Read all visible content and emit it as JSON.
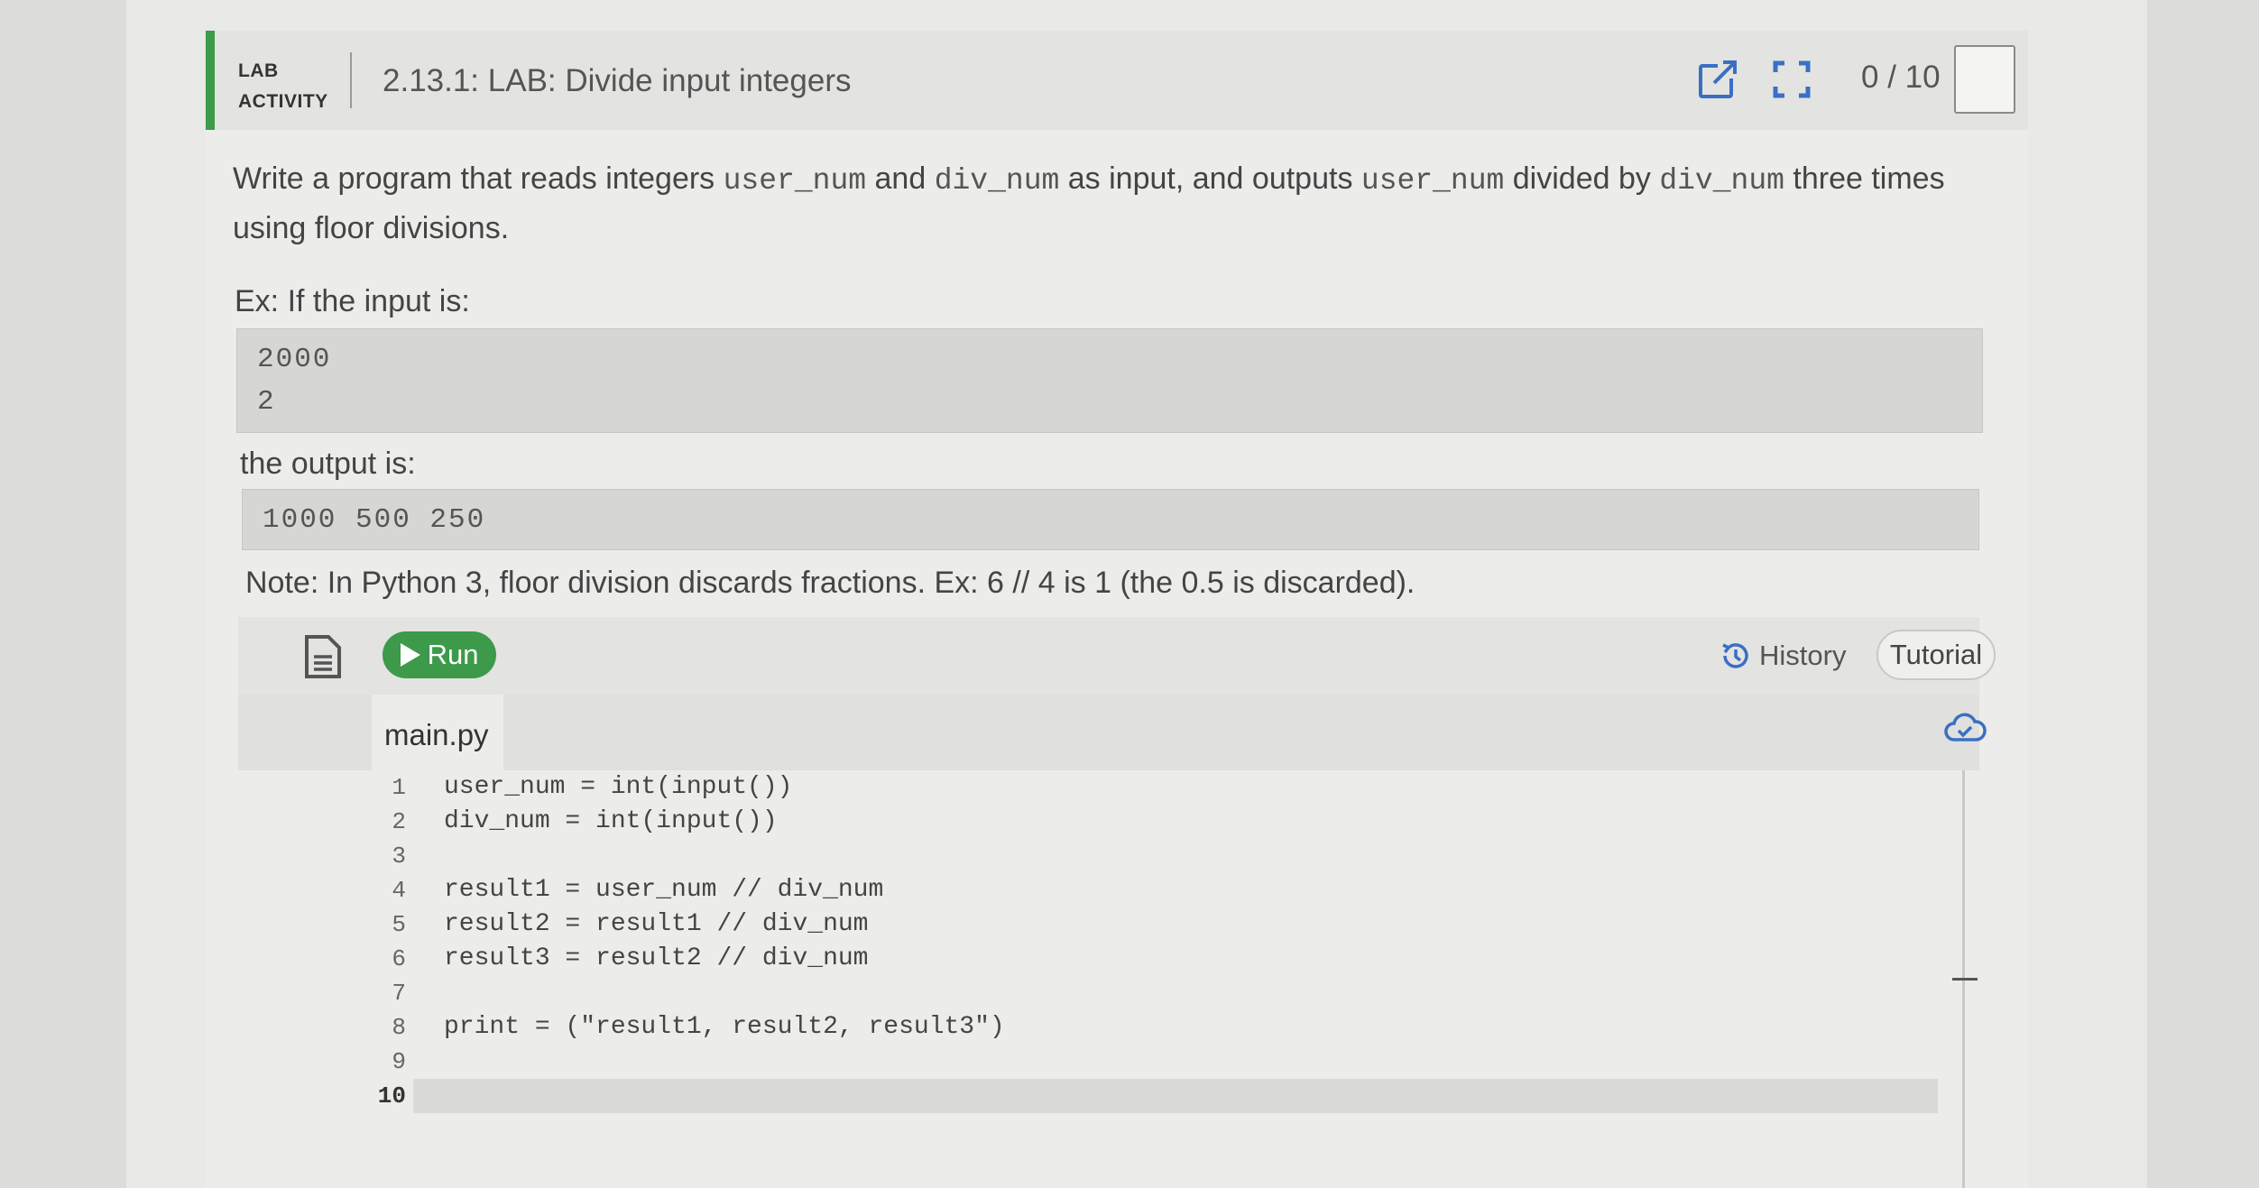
{
  "header": {
    "lab_line1": "LAB",
    "lab_line2": "ACTIVITY",
    "title": "2.13.1: LAB: Divide input integers",
    "score": "0 / 10",
    "icons": [
      "open-external-icon",
      "fullscreen-icon"
    ]
  },
  "instructions": {
    "p1_a": "Write a program that reads integers ",
    "p1_code1": "user_num",
    "p1_b": " and ",
    "p1_code2": "div_num",
    "p1_c": " as input, and outputs ",
    "p1_code3": "user_num",
    "p1_d": " divided by ",
    "p1_code4": "div_num",
    "p1_e": " three times using floor divisions.",
    "ex_label": "Ex: If the input is:",
    "input_lines": [
      "2000",
      "2"
    ],
    "output_label": "the output is:",
    "output_line": "1000 500 250",
    "note": "Note: In Python 3, floor division discards fractions. Ex: 6 // 4 is 1 (the 0.5 is discarded)."
  },
  "editor": {
    "run_label": "Run",
    "history_label": "History",
    "tutorial_label": "Tutorial",
    "file_tab": "main.py",
    "line_numbers": [
      "1",
      "2",
      "3",
      "4",
      "5",
      "6",
      "7",
      "8",
      "9",
      "10"
    ],
    "lines": [
      "user_num = int(input())",
      "div_num = int(input())",
      "",
      "result1 = user_num // div_num",
      "result2 = result1 // div_num",
      "result3 = result2 // div_num",
      "",
      "print = (\"result1, result2, result3\")",
      "",
      ""
    ]
  },
  "colors": {
    "accent_green": "#3c9a4a",
    "header_bg": "#e3e3e1",
    "code_block_bg": "#d6d6d4"
  }
}
